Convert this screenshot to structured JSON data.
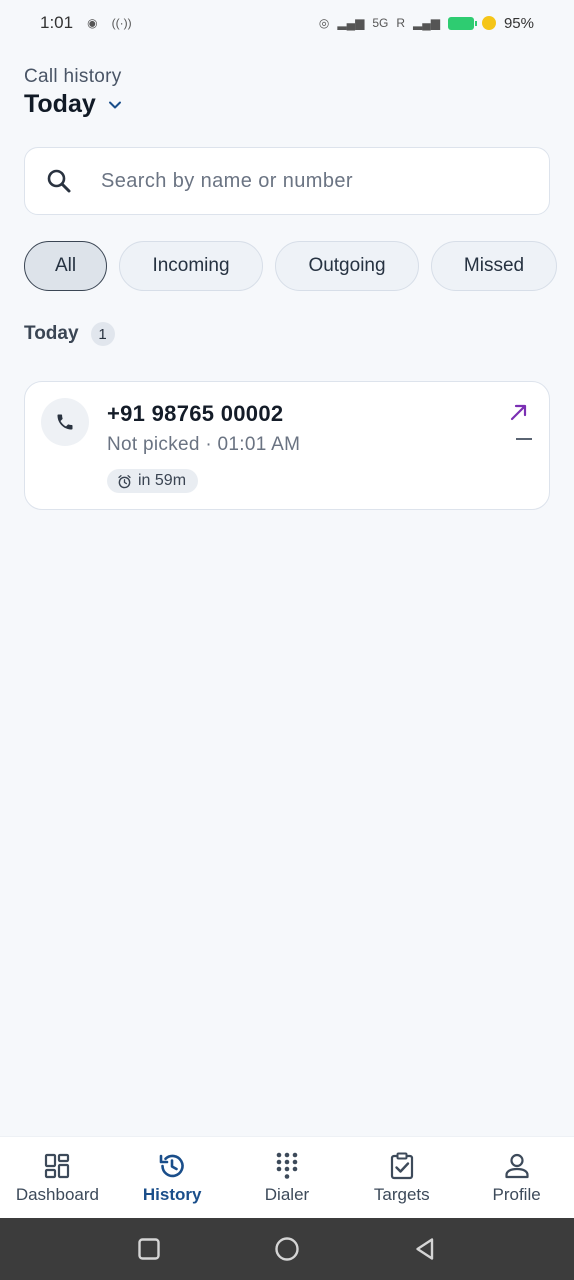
{
  "status_bar": {
    "time": "1:01",
    "network": "5G",
    "roaming": "R",
    "battery": "95%"
  },
  "header": {
    "subtitle": "Call history",
    "title": "Today"
  },
  "search": {
    "placeholder": "Search by name or number",
    "value": ""
  },
  "filters": [
    {
      "label": "All",
      "active": true
    },
    {
      "label": "Incoming",
      "active": false
    },
    {
      "label": "Outgoing",
      "active": false
    },
    {
      "label": "Missed",
      "active": false
    }
  ],
  "section": {
    "label": "Today",
    "count": "1"
  },
  "calls": [
    {
      "number": "+91 98765 00002",
      "meta": "Not picked · 01:01 AM",
      "reminder": "in 59m",
      "direction_icon": "outgoing-arrow-icon",
      "direction_color": "#7b2fb3"
    }
  ],
  "bottom_nav": [
    {
      "label": "Dashboard",
      "icon": "dashboard-icon",
      "active": false
    },
    {
      "label": "History",
      "icon": "history-icon",
      "active": true
    },
    {
      "label": "Dialer",
      "icon": "dialpad-icon",
      "active": false
    },
    {
      "label": "Targets",
      "icon": "clipboard-check-icon",
      "active": false
    },
    {
      "label": "Profile",
      "icon": "person-icon",
      "active": false
    }
  ],
  "colors": {
    "accent": "#1a4e8a",
    "background": "#f6f8fb",
    "outgoing": "#7b2fb3"
  }
}
